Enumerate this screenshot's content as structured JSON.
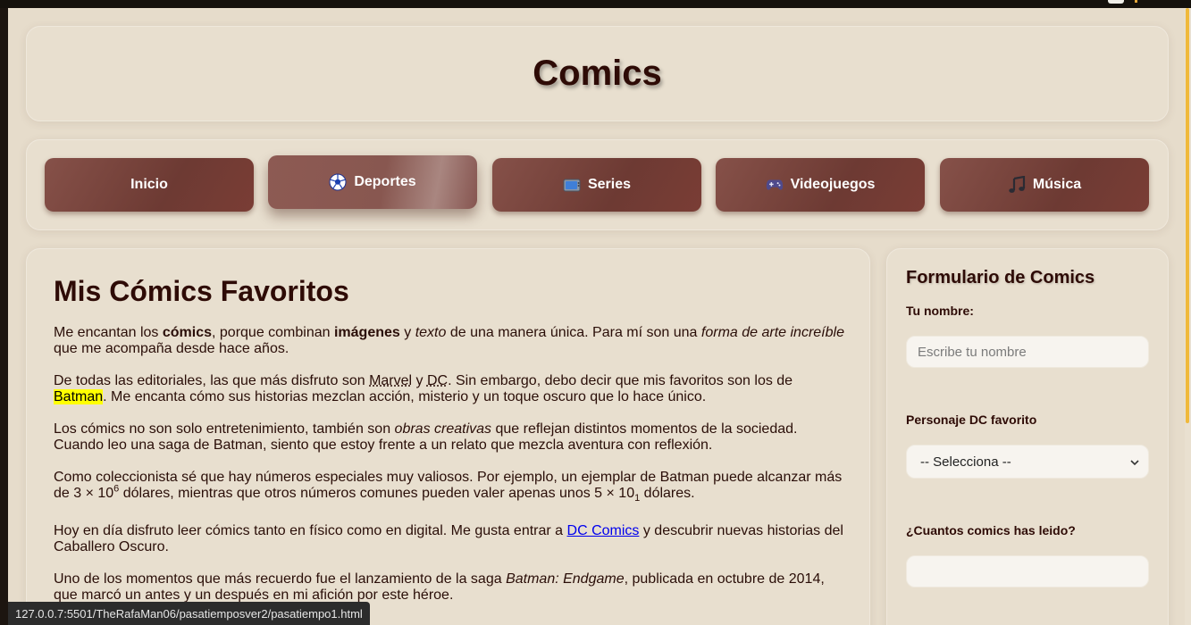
{
  "header": {
    "title": "Comics"
  },
  "nav": {
    "items": [
      {
        "label": "Inicio",
        "icon": ""
      },
      {
        "label": "Deportes",
        "icon": "soccer-ball-icon"
      },
      {
        "label": "Series",
        "icon": "television-icon"
      },
      {
        "label": "Videojuegos",
        "icon": "gamepad-icon"
      },
      {
        "label": "Música",
        "icon": "music-note-icon"
      }
    ],
    "active_index": 1
  },
  "main": {
    "title": "Mis Cómics Favoritos",
    "p1": {
      "t1": "Me encantan los ",
      "b1": "cómics",
      "t2": ", porque combinan ",
      "b2": "imágenes",
      "t3": " y ",
      "i1": "texto",
      "t4": " de una manera única. Para mí son una ",
      "i2": "forma de arte increíble",
      "t5": " que me acompaña desde hace años."
    },
    "p2": {
      "t1": "De todas las editoriales, las que más disfruto son ",
      "abbr1": "Marvel",
      "t2": " y ",
      "abbr2": "DC",
      "t3": ". Sin embargo, debo decir que mis favoritos son los de ",
      "highlight": "Batman",
      "t4": ". Me encanta cómo sus historias mezclan acción, misterio y un toque oscuro que lo hace único."
    },
    "p3": {
      "t1": "Los cómics no son solo entretenimiento, también son ",
      "i1": "obras creativas",
      "t2": " que reflejan distintos momentos de la sociedad. Cuando leo una saga de Batman, siento que estoy frente a un relato que mezcla aventura con reflexión."
    },
    "p4": {
      "t1": "Como coleccionista sé que hay números especiales muy valiosos. Por ejemplo, un ejemplar de Batman puede alcanzar más de 3 × 10",
      "sup": "6",
      "t2": " dólares, mientras que otros números comunes pueden valer apenas unos 5 × 10",
      "sub": "1",
      "t3": " dólares."
    },
    "p5": {
      "t1": "Hoy en día disfruto leer cómics tanto en físico como en digital. Me gusta entrar a ",
      "link": "DC Comics",
      "t2": " y descubrir nuevas historias del Caballero Oscuro."
    },
    "p6": {
      "t1": "Uno de los momentos que más recuerdo fue el lanzamiento de la saga ",
      "i1": "Batman: Endgame",
      "t2": ", publicada en octubre de 2014, que marcó un antes y un después en mi afición por este héroe."
    }
  },
  "form": {
    "title": "Formulario de Comics",
    "name_label": "Tu nombre:",
    "name_placeholder": "Escribe tu nombre",
    "character_label": "Personaje DC favorito",
    "character_selected": "-- Selecciona --",
    "count_label": "¿Cuantos comics has leido?",
    "count_value": ""
  },
  "statusbar": {
    "url": "127.0.0.7:5501/TheRafaMan06/pasatiemposver2/pasatiempo1.html"
  },
  "colors": {
    "background": "#e6dccb",
    "nav_button": "#7a443d",
    "heading": "#2e0b06",
    "highlight": "#ffff00",
    "scroll_thumb": "#f0b93b"
  }
}
